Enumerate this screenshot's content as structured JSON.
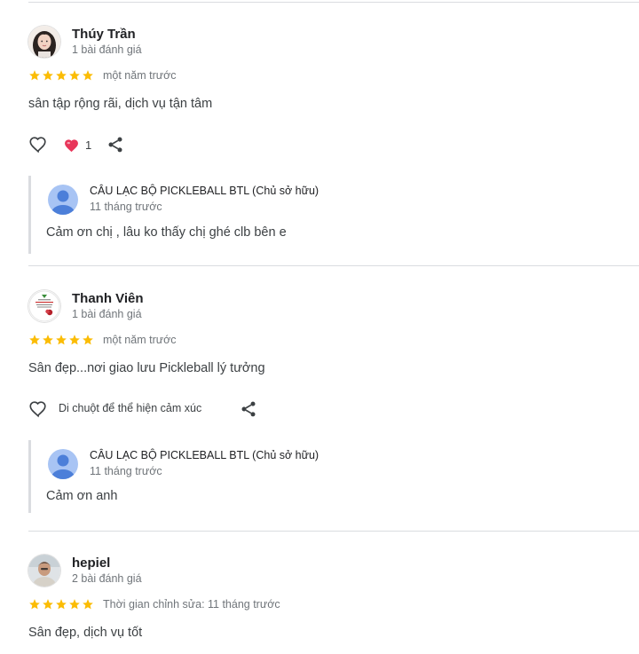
{
  "colors": {
    "star": "#fbbc04",
    "heart_reaction": "#e8365a",
    "owner_avatar_bg": "#a8c4f4",
    "owner_avatar_fg": "#4c7fd9",
    "divider": "#dadce0"
  },
  "reviews": [
    {
      "name": "Thúy Trần",
      "count": "1 bài đánh giá",
      "rating": 5,
      "time": "một năm trước",
      "text": "sân tập rộng rãi, dịch vụ tận tâm",
      "like_count": "1",
      "owner_reply": {
        "name": "CÂU LẠC BỘ PICKLEBALL BTL (Chủ sở hữu)",
        "time": "11 tháng trước",
        "text": "Cảm ơn chị , lâu ko thấy chị ghé clb bên e"
      }
    },
    {
      "name": "Thanh Viên",
      "count": "1 bài đánh giá",
      "rating": 5,
      "time": "một năm trước",
      "text": "Sân đẹp...nơi giao lưu Pickleball lý tưởng",
      "hint": "Di chuột để thể hiện cảm xúc",
      "owner_reply": {
        "name": "CÂU LẠC BỘ PICKLEBALL BTL (Chủ sở hữu)",
        "time": "11 tháng trước",
        "text": "Cảm ơn anh"
      }
    },
    {
      "name": "hepiel",
      "count": "2 bài đánh giá",
      "rating": 5,
      "time": "Thời gian chỉnh sửa: 11 tháng trước",
      "text": "Sân đẹp, dịch vụ tốt"
    }
  ]
}
